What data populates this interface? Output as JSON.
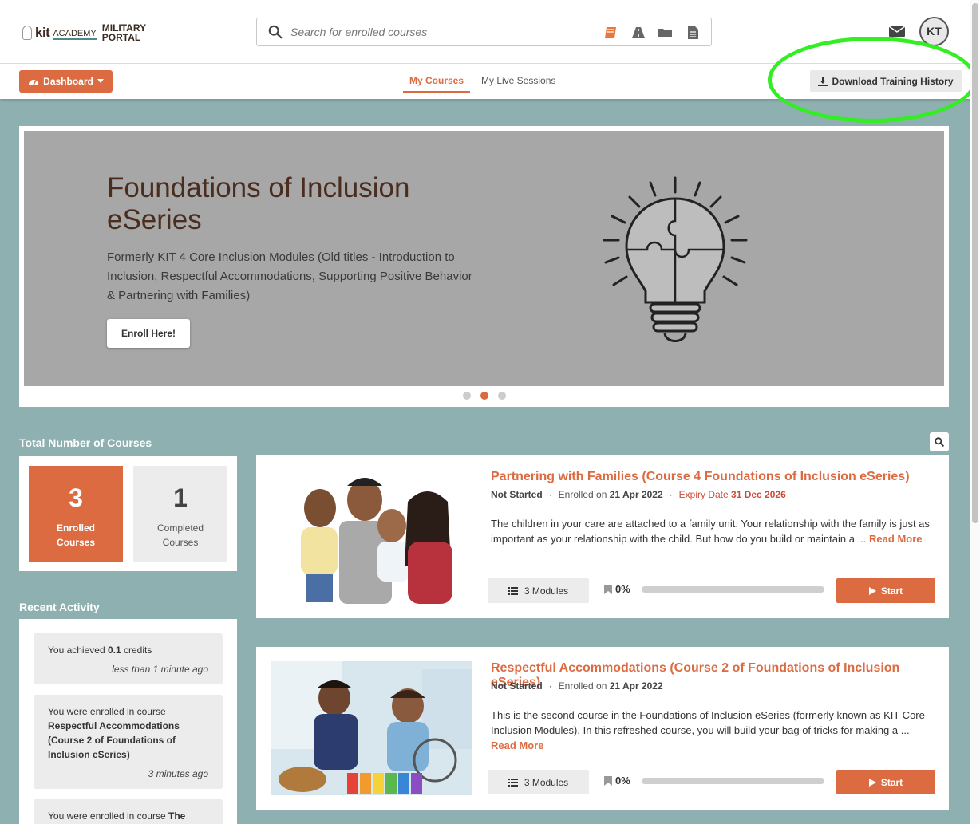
{
  "logo": {
    "brand": "kit",
    "academy": "ACADEMY",
    "portal_line1": "MILITARY",
    "portal_line2": "PORTAL"
  },
  "search": {
    "placeholder": "Search for enrolled courses",
    "filter_icons": [
      "book-icon",
      "road-icon",
      "folder-icon",
      "document-icon"
    ]
  },
  "header": {
    "avatar_initials": "KT"
  },
  "subnav": {
    "dashboard_label": "Dashboard",
    "tabs": [
      {
        "label": "My Courses",
        "active": true
      },
      {
        "label": "My Live Sessions",
        "active": false
      }
    ],
    "download_label": "Download Training History"
  },
  "hero": {
    "title": "Foundations of Inclusion eSeries",
    "description": "Formerly KIT 4 Core Inclusion Modules (Old titles - Introduction to Inclusion, Respectful Accommodations, Supporting Positive Behavior & Partnering with Families)",
    "button_label": "Enroll Here!",
    "slides": 3,
    "active_slide": 2
  },
  "stats": {
    "section_title": "Total Number of Courses",
    "enrolled": {
      "count": "3",
      "label": "Enrolled Courses"
    },
    "completed": {
      "count": "1",
      "label": "Completed Courses"
    }
  },
  "activity": {
    "section_title": "Recent Activity",
    "items": [
      {
        "prefix": "You achieved ",
        "strong": "0.1",
        "suffix": " credits",
        "when": "less than 1 minute ago"
      },
      {
        "prefix": "You were enrolled in course ",
        "strong": "Respectful Accommodations (Course 2 of Foundations of Inclusion eSeries)",
        "suffix": "",
        "when": "3 minutes ago"
      },
      {
        "prefix": "You were enrolled in course ",
        "strong": "The",
        "suffix": "",
        "when": ""
      }
    ]
  },
  "courses": [
    {
      "title": "Partnering with Families (Course 4 Foundations of Inclusion eSeries)",
      "status": "Not Started",
      "enrolled_prefix": "Enrolled on ",
      "enrolled_date": "21 Apr 2022",
      "expiry_prefix": "Expiry Date ",
      "expiry_date": "31 Dec 2026",
      "description": "The children in your care are attached to a family unit.  Your relationship with the family is just as important as your relationship with the child.  But how do you build or maintain a ...",
      "read_more": "Read More",
      "modules": "3 Modules",
      "progress_label": "0%",
      "progress": 0,
      "start_label": "Start"
    },
    {
      "title": "Respectful Accommodations (Course 2 of Foundations of Inclusion eSeries)",
      "status": "Not Started",
      "enrolled_prefix": "Enrolled on ",
      "enrolled_date": "21 Apr 2022",
      "description": "This is the second course in the Foundations of Inclusion eSeries (formerly known as KIT Core Inclusion Modules). In this refreshed course, you will build your bag of tricks for making a ...",
      "read_more": "Read More",
      "modules": "3 Modules",
      "progress_label": "0%",
      "progress": 0,
      "start_label": "Start"
    }
  ],
  "colors": {
    "accent": "#dd6b42",
    "background": "#8fb0b0",
    "highlight": "#33ee22",
    "expiry": "#cc4b3b"
  }
}
